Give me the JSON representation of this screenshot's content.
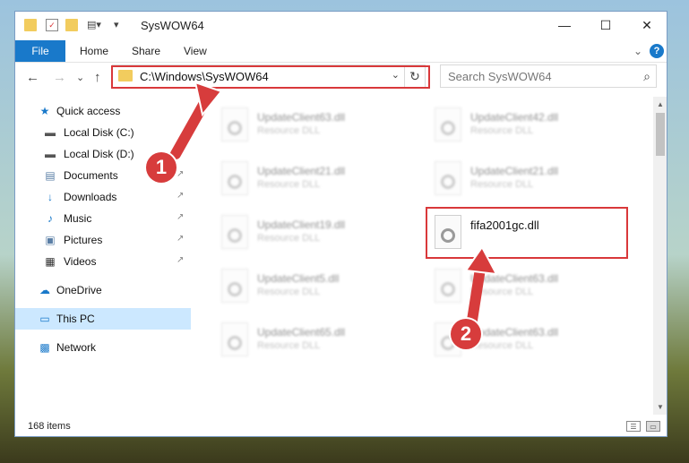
{
  "window": {
    "title": "SysWOW64",
    "minimize": "—",
    "maximize": "☐",
    "close": "✕"
  },
  "ribbon": {
    "tabs": [
      "File",
      "Home",
      "Share",
      "View"
    ],
    "help": "?",
    "expand": "⌄"
  },
  "navigation": {
    "back": "←",
    "forward": "→",
    "recent": "⌄",
    "up": "↑"
  },
  "address": {
    "path": "C:\\Windows\\SysWOW64",
    "chevron": "⌄",
    "refresh": "↻"
  },
  "search": {
    "placeholder": "Search SysWOW64",
    "icon": "⌕"
  },
  "sidebar": {
    "items": [
      {
        "label": "Quick access",
        "icon": "★"
      },
      {
        "label": "Local Disk (C:)",
        "icon": "▬"
      },
      {
        "label": "Local Disk (D:)",
        "icon": "▬"
      },
      {
        "label": "Documents",
        "icon": "▤"
      },
      {
        "label": "Downloads",
        "icon": "↓"
      },
      {
        "label": "Music",
        "icon": "♪"
      },
      {
        "label": "Pictures",
        "icon": "▣"
      },
      {
        "label": "Videos",
        "icon": "▦"
      },
      {
        "label": "OneDrive",
        "icon": "☁"
      },
      {
        "label": "This PC",
        "icon": "▭"
      },
      {
        "label": "Network",
        "icon": "▩"
      }
    ],
    "pin": "↗"
  },
  "files": [
    {
      "name": "UpdateClient63.dll",
      "type": "Resource DLL"
    },
    {
      "name": "UpdateClient42.dll",
      "type": "Resource DLL"
    },
    {
      "name": "UpdateClient21.dll",
      "type": "Resource DLL"
    },
    {
      "name": "UpdateClient21.dll",
      "type": "Resource DLL"
    },
    {
      "name": "UpdateClient19.dll",
      "type": "Resource DLL"
    },
    {
      "name": "fifa2001gc.dll",
      "type": ""
    },
    {
      "name": "UpdateClient5.dll",
      "type": "Resource DLL"
    },
    {
      "name": "UpdateClient63.dll",
      "type": "Resource DLL"
    },
    {
      "name": "UpdateClient65.dll",
      "type": "Resource DLL"
    },
    {
      "name": "UpdateClient63.dll",
      "type": "Resource DLL"
    }
  ],
  "status": {
    "items": "168 items"
  },
  "annotations": {
    "step1": "1",
    "step2": "2"
  },
  "colors": {
    "accent": "#1979ca",
    "highlight": "#d9383a",
    "selected": "#cce8ff"
  }
}
